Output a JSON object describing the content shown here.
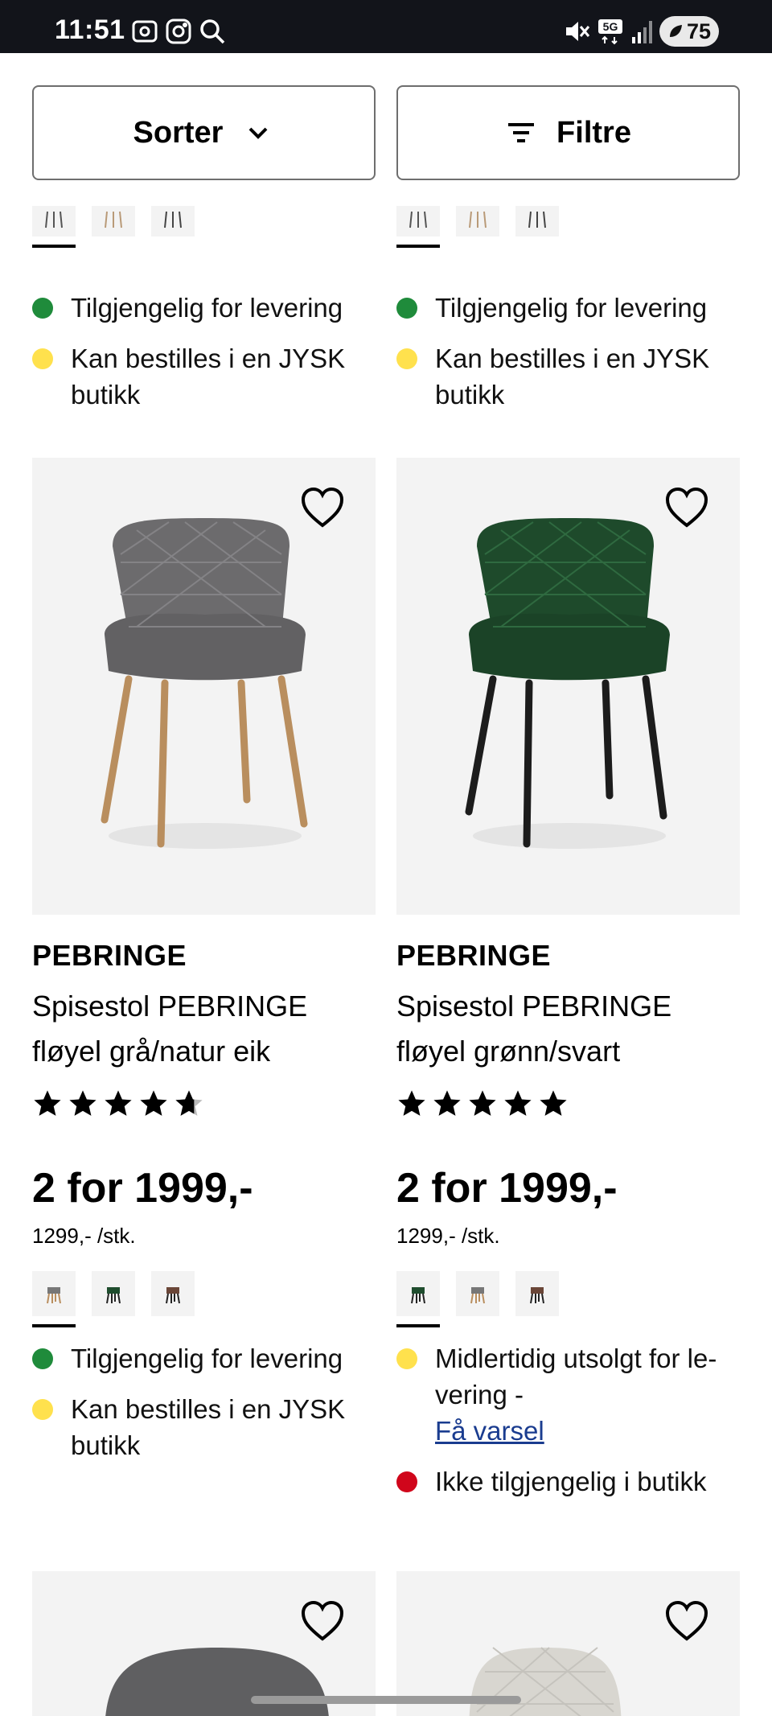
{
  "status_bar": {
    "time": "11:51",
    "battery": "75"
  },
  "controls": {
    "sort_label": "Sorter",
    "filter_label": "Filtre"
  },
  "top_row": [
    {
      "availability": [
        "Tilgjengelig for levering",
        "Kan bestilles i en JYSK butikk"
      ]
    },
    {
      "availability": [
        "Tilgjengelig for levering",
        "Kan bestilles i en JYSK butikk"
      ]
    }
  ],
  "products": [
    {
      "brand": "PEBRINGE",
      "name": "Spisestol PEBRINGE fløyel grå/natur eik",
      "rating": 4.5,
      "price": "2 for 1999,-",
      "unit_price": "1299,- /stk.",
      "availability": [
        {
          "status": "green",
          "text": "Tilgjengelig for levering"
        },
        {
          "status": "yellow",
          "text": "Kan bestilles i en JYSK butikk"
        }
      ]
    },
    {
      "brand": "PEBRINGE",
      "name": "Spisestol PEBRINGE fløyel grønn/svart",
      "rating": 5,
      "price": "2 for 1999,-",
      "unit_price": "1299,- /stk.",
      "availability": [
        {
          "status": "yellow",
          "text": "Midlertidig utsolgt for le-vering -",
          "link": "Få varsel"
        },
        {
          "status": "red",
          "text": "Ikke tilgjengelig i butikk"
        }
      ]
    }
  ],
  "colors": {
    "green": "#1f8b3b",
    "yellow": "#ffe14d",
    "red": "#d0061b",
    "link": "#1a3c8f"
  }
}
